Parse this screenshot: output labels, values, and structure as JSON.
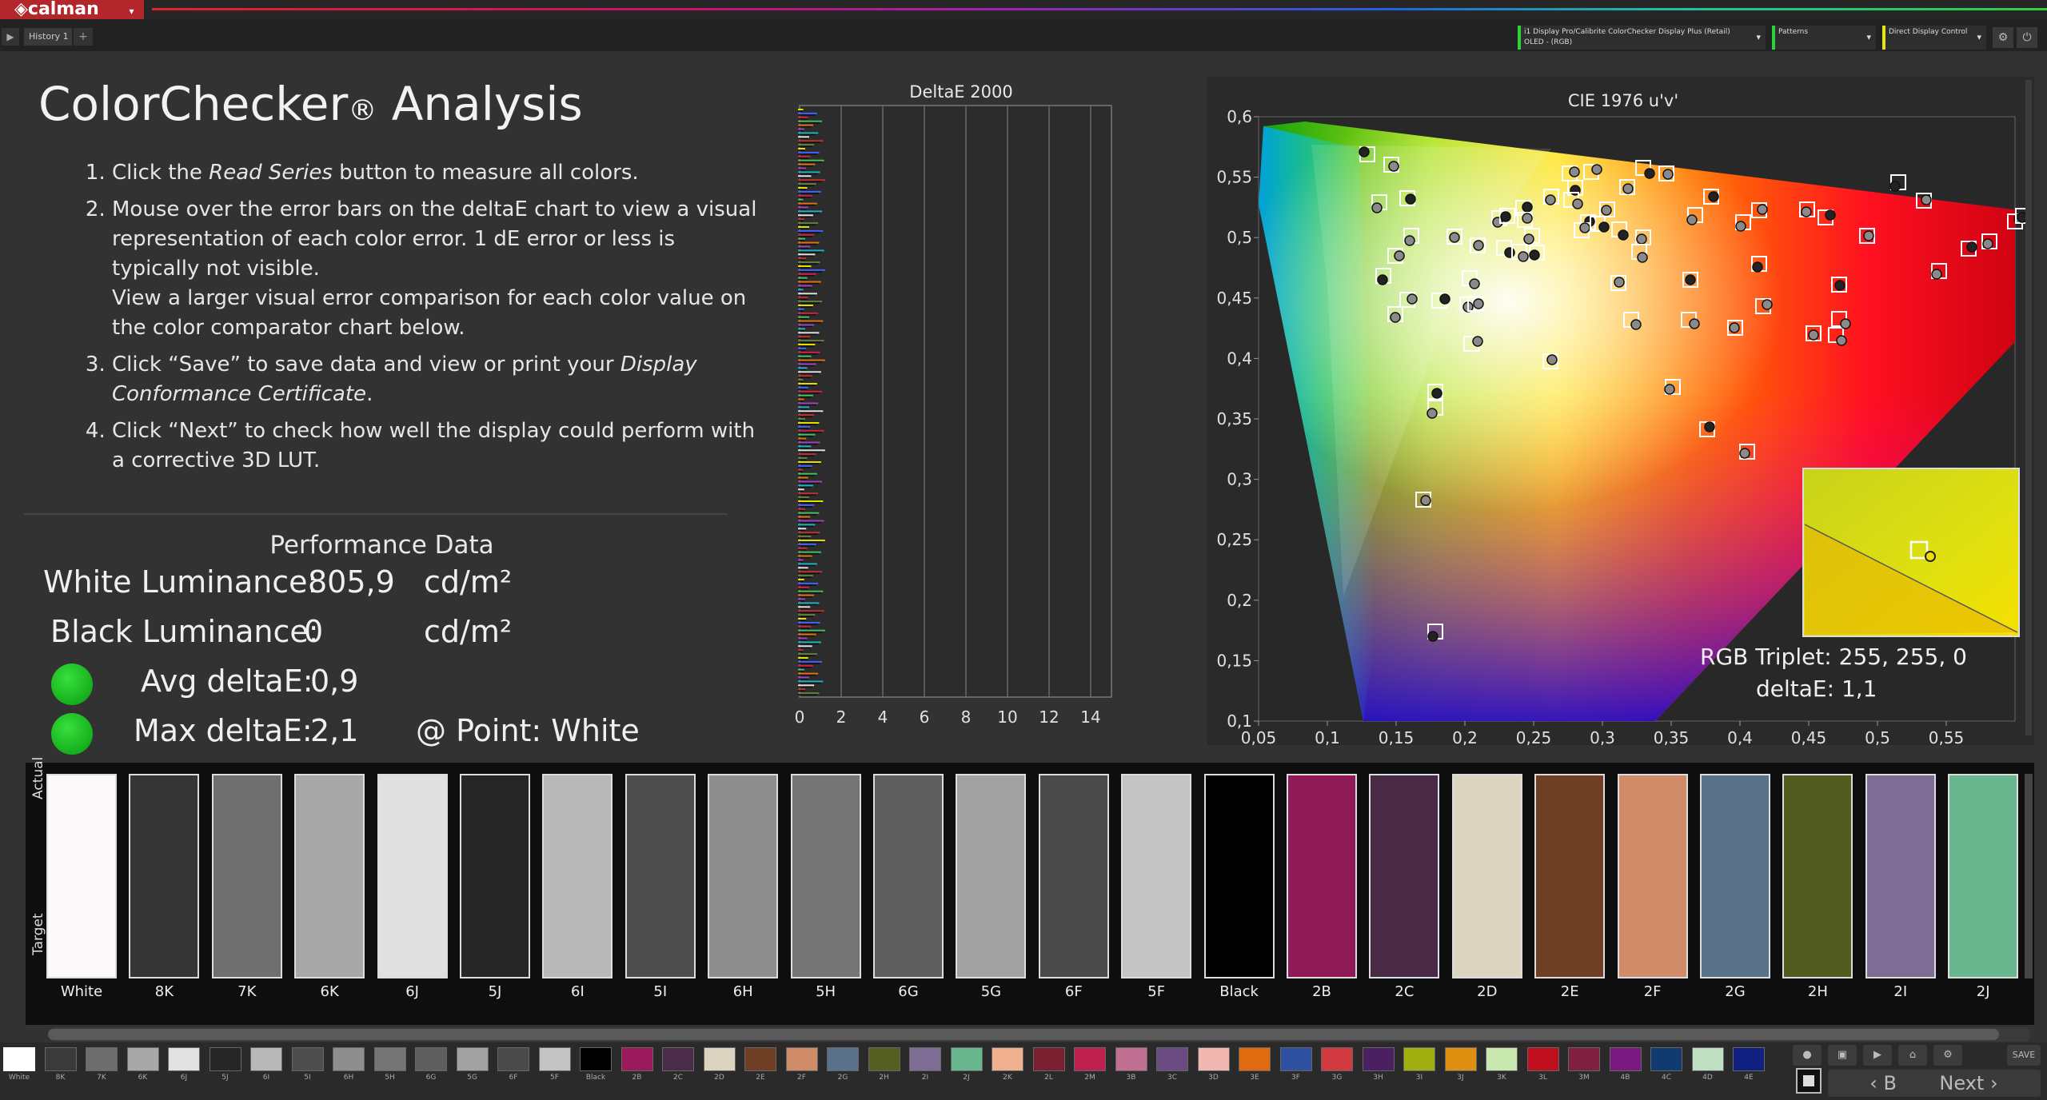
{
  "app": {
    "logo": "◈calman",
    "tab": "History 1",
    "tab_add": "+"
  },
  "devices": [
    {
      "label": "i1 Display Pro/Calibrite ColorChecker Display Plus (Retail)",
      "sub": "OLED - (RGB)"
    },
    {
      "label": "Patterns",
      "sub": ""
    },
    {
      "label": "Direct Display Control",
      "sub": ""
    }
  ],
  "page": {
    "title_main": "ColorChecker",
    "title_reg": "®",
    "title_rest": " Analysis"
  },
  "steps": {
    "s1_pre": "Click the ",
    "s1_em": "Read Series",
    "s1_post": " button to measure all colors.",
    "s2": "Mouse over the error bars on the deltaE chart to view a visual representation of each color error. 1 dE error or less is typically not visible.",
    "s2b": "View a larger visual error comparison for each color value on the color comparator chart below.",
    "s3_pre": "Click “Save” to save data and view or print your ",
    "s3_em": "Display Conformance Certificate",
    "s3_post": ".",
    "s4": "Click “Next” to check how well the display could perform with a corrective 3D LUT."
  },
  "performance": {
    "title": "Performance Data",
    "white_label": "White Luminance:",
    "white_value": "805,9",
    "white_unit": "cd/m²",
    "black_label": "Black Luminance:",
    "black_value": "0",
    "black_unit": "cd/m²",
    "avg_label": "Avg deltaE:",
    "avg_value": "0,9",
    "max_label": "Max deltaE:",
    "max_value": "2,1",
    "point_label": "@ Point: White"
  },
  "deltae_chart": {
    "title": "DeltaE 2000",
    "ticks": [
      "0",
      "2",
      "4",
      "6",
      "8",
      "10",
      "12",
      "14"
    ]
  },
  "cie_chart": {
    "title": "CIE 1976 u'v'",
    "x_ticks": [
      "0,05",
      "0,1",
      "0,15",
      "0,2",
      "0,25",
      "0,3",
      "0,35",
      "0,4",
      "0,45",
      "0,5",
      "0,55"
    ],
    "y_ticks": [
      "0,6",
      "0,55",
      "0,5",
      "0,45",
      "0,4",
      "0,35",
      "0,3",
      "0,25",
      "0,2",
      "0,15",
      "0,1"
    ],
    "rgb_triplet": "RGB Triplet: 255, 255, 0",
    "deltae": "deltaE: 1,1"
  },
  "comparator": {
    "actual_label": "Actual",
    "target_label": "Target",
    "swatches": [
      {
        "label": "White",
        "color": "#fdf9fb"
      },
      {
        "label": "8K",
        "color": "#353535"
      },
      {
        "label": "7K",
        "color": "#6f6f6f"
      },
      {
        "label": "6K",
        "color": "#a8a8a8"
      },
      {
        "label": "6J",
        "color": "#e0e0e0"
      },
      {
        "label": "5J",
        "color": "#262626"
      },
      {
        "label": "6I",
        "color": "#b8b8b8"
      },
      {
        "label": "5I",
        "color": "#4e4e4e"
      },
      {
        "label": "6H",
        "color": "#8e8e8e"
      },
      {
        "label": "5H",
        "color": "#757575"
      },
      {
        "label": "6G",
        "color": "#5e5e5e"
      },
      {
        "label": "5G",
        "color": "#a2a2a2"
      },
      {
        "label": "6F",
        "color": "#4a4a4a"
      },
      {
        "label": "5F",
        "color": "#c4c4c4"
      },
      {
        "label": "Black",
        "color": "#000000"
      },
      {
        "label": "2B",
        "color": "#8f1a55"
      },
      {
        "label": "2C",
        "color": "#482a45"
      },
      {
        "label": "2D",
        "color": "#ddd5c2"
      },
      {
        "label": "2E",
        "color": "#6e3f24"
      },
      {
        "label": "2F",
        "color": "#d08b68"
      },
      {
        "label": "2G",
        "color": "#5a7289"
      },
      {
        "label": "2H",
        "color": "#525b20"
      },
      {
        "label": "2I",
        "color": "#7d6d94"
      },
      {
        "label": "2J",
        "color": "#68b78e"
      }
    ]
  },
  "bottom_swatches": [
    {
      "label": "White",
      "color": "#ffffff"
    },
    {
      "label": "8K",
      "color": "#3a3a3a"
    },
    {
      "label": "7K",
      "color": "#6e6e6e"
    },
    {
      "label": "6K",
      "color": "#a8a8a8"
    },
    {
      "label": "6J",
      "color": "#e2e2e2"
    },
    {
      "label": "5J",
      "color": "#262626"
    },
    {
      "label": "6I",
      "color": "#b8b8b8"
    },
    {
      "label": "5I",
      "color": "#4e4e4e"
    },
    {
      "label": "6H",
      "color": "#8e8e8e"
    },
    {
      "label": "5H",
      "color": "#757575"
    },
    {
      "label": "6G",
      "color": "#5e5e5e"
    },
    {
      "label": "5G",
      "color": "#a2a2a2"
    },
    {
      "label": "6F",
      "color": "#4a4a4a"
    },
    {
      "label": "5F",
      "color": "#c4c4c4"
    },
    {
      "label": "Black",
      "color": "#000000"
    },
    {
      "label": "2B",
      "color": "#9a1a5c"
    },
    {
      "label": "2C",
      "color": "#4a2c48"
    },
    {
      "label": "2D",
      "color": "#dcd4c0"
    },
    {
      "label": "2E",
      "color": "#6e3f24"
    },
    {
      "label": "2F",
      "color": "#d08b68"
    },
    {
      "label": "2G",
      "color": "#5a7289"
    },
    {
      "label": "2H",
      "color": "#556020"
    },
    {
      "label": "2I",
      "color": "#7d6d94"
    },
    {
      "label": "2J",
      "color": "#68b78e"
    },
    {
      "label": "2K",
      "color": "#f0b090"
    },
    {
      "label": "2L",
      "color": "#7a2030"
    },
    {
      "label": "2M",
      "color": "#c02050"
    },
    {
      "label": "3B",
      "color": "#c07090"
    },
    {
      "label": "3C",
      "color": "#6a4a80"
    },
    {
      "label": "3D",
      "color": "#f0b8b0"
    },
    {
      "label": "3E",
      "color": "#e06a10"
    },
    {
      "label": "3F",
      "color": "#3050a0"
    },
    {
      "label": "3G",
      "color": "#d03a40"
    },
    {
      "label": "3H",
      "color": "#4a2060"
    },
    {
      "label": "3I",
      "color": "#a0b010"
    },
    {
      "label": "3J",
      "color": "#e09010"
    },
    {
      "label": "3K",
      "color": "#c8e8b0"
    },
    {
      "label": "3L",
      "color": "#c01020"
    },
    {
      "label": "3M",
      "color": "#802040"
    },
    {
      "label": "4B",
      "color": "#7a1a80"
    },
    {
      "label": "4C",
      "color": "#103a70"
    },
    {
      "label": "4D",
      "color": "#bfe0c0"
    },
    {
      "label": "4E",
      "color": "#102080"
    }
  ],
  "nav": {
    "back": "Back",
    "next": "Next",
    "save": "SAVE"
  }
}
